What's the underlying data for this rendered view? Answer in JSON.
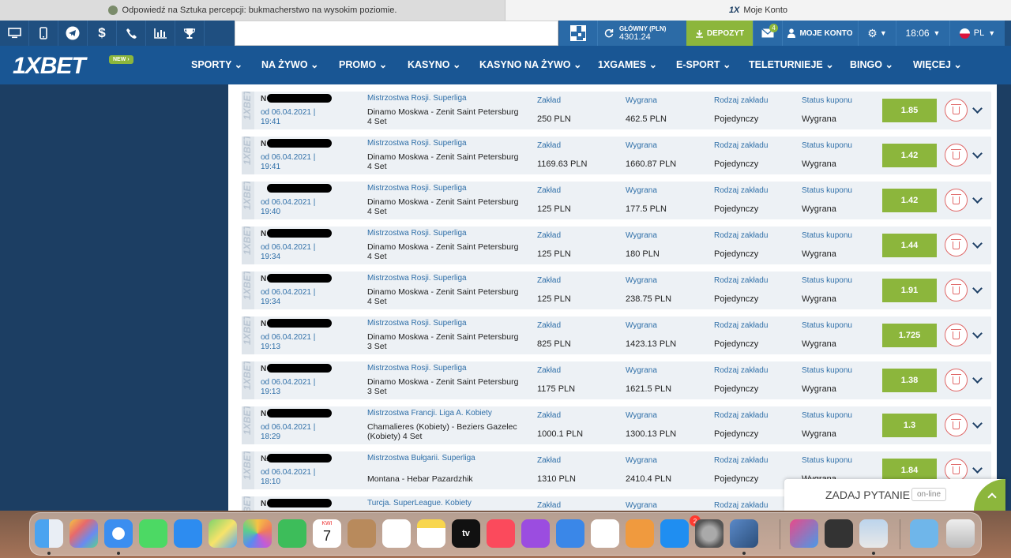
{
  "browser": {
    "tab_left_title": "Odpowiedź na Sztuka percepcji: bukmacherstwo na wysokim poziomie.",
    "tab_right_logo": "1X",
    "tab_right_title": "Moje Konto"
  },
  "toolbar": {
    "icons": [
      "desktop-icon",
      "mobile-icon",
      "telegram-icon",
      "dollar-icon",
      "phone-icon",
      "stats-icon",
      "trophy-icon"
    ],
    "balance_label": "GŁÓWNY (PLN)",
    "balance_value": "4301.24",
    "deposit_label": "DEPOZYT",
    "mail_badge": "4",
    "account_label": "MOJE KONTO",
    "time": "18:06",
    "language": "PL"
  },
  "nav": {
    "logo": "1XBET",
    "new_badge": "NEW",
    "items": [
      "SPORTY",
      "NA ŻYWO",
      "PROMO",
      "KASYNO",
      "KASYNO NA ŻYWO",
      "1XGAMES",
      "E-SPORT",
      "TELETURNIEJE",
      "BINGO",
      "WIĘCEJ"
    ]
  },
  "columns": {
    "stake": "Zakład",
    "win": "Wygrana",
    "type": "Rodzaj zakładu",
    "status": "Status kuponu"
  },
  "bets": [
    {
      "id": "N",
      "date": "od 06.04.2021 |",
      "time": "19:41",
      "league": "Mistrzostwa Rosji. Superliga",
      "match": "Dinamo Moskwa - Zenit Saint Petersburg",
      "detail": "4 Set",
      "stake": "250 PLN",
      "win": "462.5 PLN",
      "type": "Pojedynczy",
      "status": "Wygrana",
      "odds": "1.85"
    },
    {
      "id": "N",
      "date": "od 06.04.2021 |",
      "time": "19:41",
      "league": "Mistrzostwa Rosji. Superliga",
      "match": "Dinamo Moskwa - Zenit Saint Petersburg",
      "detail": "4 Set",
      "stake": "1169.63 PLN",
      "win": "1660.87 PLN",
      "type": "Pojedynczy",
      "status": "Wygrana",
      "odds": "1.42"
    },
    {
      "id": "",
      "date": "od 06.04.2021 |",
      "time": "19:40",
      "league": "Mistrzostwa Rosji. Superliga",
      "match": "Dinamo Moskwa - Zenit Saint Petersburg",
      "detail": "4 Set",
      "stake": "125 PLN",
      "win": "177.5 PLN",
      "type": "Pojedynczy",
      "status": "Wygrana",
      "odds": "1.42"
    },
    {
      "id": "N",
      "date": "od 06.04.2021 |",
      "time": "19:34",
      "league": "Mistrzostwa Rosji. Superliga",
      "match": "Dinamo Moskwa - Zenit Saint Petersburg",
      "detail": "4 Set",
      "stake": "125 PLN",
      "win": "180 PLN",
      "type": "Pojedynczy",
      "status": "Wygrana",
      "odds": "1.44"
    },
    {
      "id": "N",
      "date": "od 06.04.2021 |",
      "time": "19:34",
      "league": "Mistrzostwa Rosji. Superliga",
      "match": "Dinamo Moskwa - Zenit Saint Petersburg",
      "detail": "4 Set",
      "stake": "125 PLN",
      "win": "238.75 PLN",
      "type": "Pojedynczy",
      "status": "Wygrana",
      "odds": "1.91"
    },
    {
      "id": "N",
      "date": "od 06.04.2021 |",
      "time": "19:13",
      "league": "Mistrzostwa Rosji. Superliga",
      "match": "Dinamo Moskwa - Zenit Saint Petersburg",
      "detail": "3 Set",
      "stake": "825 PLN",
      "win": "1423.13 PLN",
      "type": "Pojedynczy",
      "status": "Wygrana",
      "odds": "1.725"
    },
    {
      "id": "N",
      "date": "od 06.04.2021 |",
      "time": "19:13",
      "league": "Mistrzostwa Rosji. Superliga",
      "match": "Dinamo Moskwa - Zenit Saint Petersburg",
      "detail": "3 Set",
      "stake": "1175 PLN",
      "win": "1621.5 PLN",
      "type": "Pojedynczy",
      "status": "Wygrana",
      "odds": "1.38"
    },
    {
      "id": "N",
      "date": "od 06.04.2021 |",
      "time": "18:29",
      "league": "Mistrzostwa Francji. Liga A. Kobiety",
      "match": "Chamalieres (Kobiety) - Beziers Gazelec",
      "detail": "(Kobiety) 4 Set",
      "stake": "1000.1 PLN",
      "win": "1300.13 PLN",
      "type": "Pojedynczy",
      "status": "Wygrana",
      "odds": "1.3"
    },
    {
      "id": "№",
      "date": "od 06.04.2021 |",
      "time": "18:10",
      "league": "Mistrzostwa Bułgarii. Superliga",
      "match": "",
      "detail": "Montana - Hebar Pazardzhik",
      "stake": "1310 PLN",
      "win": "2410.4 PLN",
      "type": "Pojedynczy",
      "status": "Wygrana",
      "odds": "1.84"
    },
    {
      "id": "N",
      "date": "",
      "time": "",
      "league": "Turcja. SuperLeague. Kobiety",
      "match": "",
      "detail": "",
      "stake": "",
      "win": "",
      "type": "",
      "status": "",
      "odds": ""
    }
  ],
  "chat": {
    "label": "ZADAJ PYTANIE",
    "status": "on-line"
  },
  "dock": {
    "calendar_month": "KWI",
    "calendar_day": "7",
    "appstore_badge": "2",
    "tv_label": "tv"
  }
}
